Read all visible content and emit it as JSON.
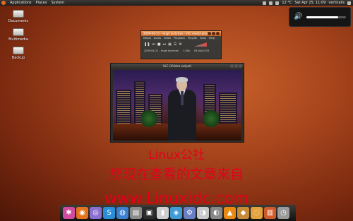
{
  "top_panel": {
    "menus": [
      "Applications",
      "Places",
      "System"
    ],
    "temperature": "12 °C",
    "datetime": "Sat Apr 25, 11:09",
    "user": "verticalis"
  },
  "desktop_icons": [
    {
      "label": "Documents"
    },
    {
      "label": "Multimedia"
    },
    {
      "label": "Backup"
    }
  ],
  "volume_osd": {
    "level": 0.8
  },
  "vlc_main": {
    "title": "2009-04-21 - Hugh Jackman - VLC media player",
    "menus": [
      "Media",
      "Audio",
      "Video",
      "Playback",
      "Playlist",
      "Tools",
      "Help"
    ],
    "status_date": "2009-04-21 - Hugh Jackman",
    "speed": "1.00x",
    "time": "04:44/43:25"
  },
  "vlc_video": {
    "title": "VLC (XVideo output)"
  },
  "watermark": {
    "line1": "Linux公社",
    "line2": "您现在查看的文章来自",
    "line3": "www.Linuxidc.com"
  },
  "dock_icons": [
    "system-icon",
    "firefox-icon",
    "pidgin-icon",
    "skype-icon",
    "browser-icon",
    "archive-icon",
    "terminal-icon",
    "phone-icon",
    "app-icon",
    "settings-icon",
    "disc-icon",
    "cd-icon",
    "vlc-icon",
    "gimp-icon",
    "shell-icon",
    "trash-icon",
    "clock-icon"
  ]
}
